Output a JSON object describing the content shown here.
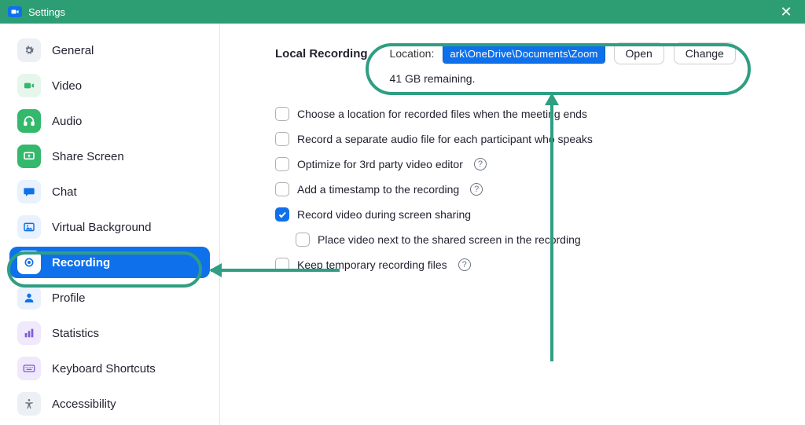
{
  "window": {
    "title": "Settings"
  },
  "sidebar": {
    "items": [
      {
        "key": "general",
        "label": "General"
      },
      {
        "key": "video",
        "label": "Video"
      },
      {
        "key": "audio",
        "label": "Audio"
      },
      {
        "key": "share",
        "label": "Share Screen"
      },
      {
        "key": "chat",
        "label": "Chat"
      },
      {
        "key": "vbg",
        "label": "Virtual Background"
      },
      {
        "key": "recording",
        "label": "Recording"
      },
      {
        "key": "profile",
        "label": "Profile"
      },
      {
        "key": "stats",
        "label": "Statistics"
      },
      {
        "key": "shortcuts",
        "label": "Keyboard Shortcuts"
      },
      {
        "key": "access",
        "label": "Accessibility"
      }
    ],
    "active_key": "recording"
  },
  "recording": {
    "section_title": "Local Recording",
    "location_label": "Location:",
    "location_path": "ark\\OneDrive\\Documents\\Zoom",
    "open_label": "Open",
    "change_label": "Change",
    "remaining": "41 GB remaining.",
    "options": [
      {
        "label": "Choose a location for recorded files when the meeting ends",
        "checked": false,
        "help": false
      },
      {
        "label": "Record a separate audio file for each participant who speaks",
        "checked": false,
        "help": false
      },
      {
        "label": "Optimize for 3rd party video editor",
        "checked": false,
        "help": true
      },
      {
        "label": "Add a timestamp to the recording",
        "checked": false,
        "help": true
      },
      {
        "label": "Record video during screen sharing",
        "checked": true,
        "help": false
      },
      {
        "label": "Place video next to the shared screen in the recording",
        "checked": false,
        "help": false,
        "sub": true
      },
      {
        "label": "Keep temporary recording files",
        "checked": false,
        "help": true
      }
    ]
  }
}
